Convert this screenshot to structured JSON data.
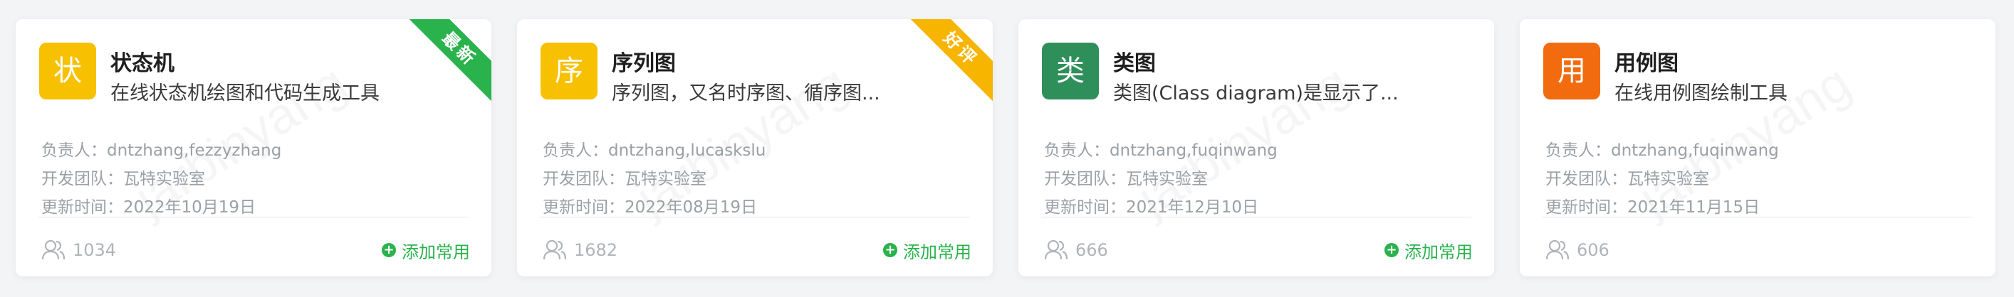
{
  "watermark": "jarbinyang",
  "cards": [
    {
      "icon_char": "状",
      "icon_color": "#F7C000",
      "title": "状态机",
      "description": "在线状态机绘图和代码生成工具",
      "ribbon": "最新",
      "ribbon_color": "#2AB24C",
      "owner": "负责人：dntzhang,fezzyzhang",
      "team": "开发团队：瓦特实验室",
      "updated": "更新时间：2022年10月19日",
      "users": "1034",
      "add_label": "添加常用"
    },
    {
      "icon_char": "序",
      "icon_color": "#F7C000",
      "title": "序列图",
      "description": "序列图，又名时序图、循序图...",
      "ribbon": "好评",
      "ribbon_color": "#F7B500",
      "owner": "负责人：dntzhang,lucaskslu",
      "team": "开发团队：瓦特实验室",
      "updated": "更新时间：2022年08月19日",
      "users": "1682",
      "add_label": "添加常用"
    },
    {
      "icon_char": "类",
      "icon_color": "#2F8F5B",
      "title": "类图",
      "description": "类图(Class diagram)是显示了...",
      "owner": "负责人：dntzhang,fuqinwang",
      "team": "开发团队：瓦特实验室",
      "updated": "更新时间：2021年12月10日",
      "users": "666",
      "add_label": "添加常用"
    },
    {
      "icon_char": "用",
      "icon_color": "#F26B0F",
      "title": "用例图",
      "description": "在线用例图绘制工具",
      "owner": "负责人：dntzhang,fuqinwang",
      "team": "开发团队：瓦特实验室",
      "updated": "更新时间：2021年11月15日",
      "users": "606"
    }
  ]
}
